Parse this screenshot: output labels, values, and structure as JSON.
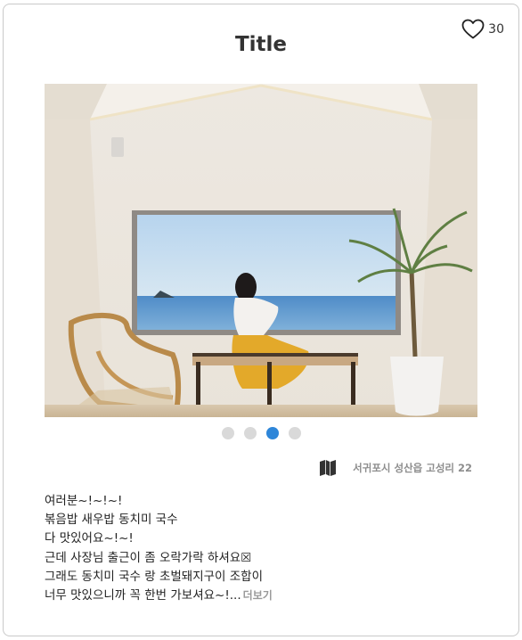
{
  "post": {
    "title": "Title",
    "likes": "30",
    "image_count": 4,
    "active_image_index": 2,
    "location": "서귀포시 성산읍 고성리 22",
    "description_lines": [
      "여러분~!~!~!",
      "볶음밥 새우밥 동치미 국수",
      "다 맛있어요~!~!",
      "근데 사장님 출근이 좀 오락가락 하셔요☒",
      "그래도 동치미 국수 랑 초벌돼지구이 조합이",
      "너무 맛있으니까 꼭 한번 가보셔요~!..."
    ],
    "more_label": "더보기"
  },
  "icons": {
    "like": "heart-outline-icon",
    "location": "map-icon"
  },
  "colors": {
    "active_dot": "#2e86d9",
    "inactive_dot": "#d9d9d9",
    "muted_text": "#8d8d8d"
  }
}
